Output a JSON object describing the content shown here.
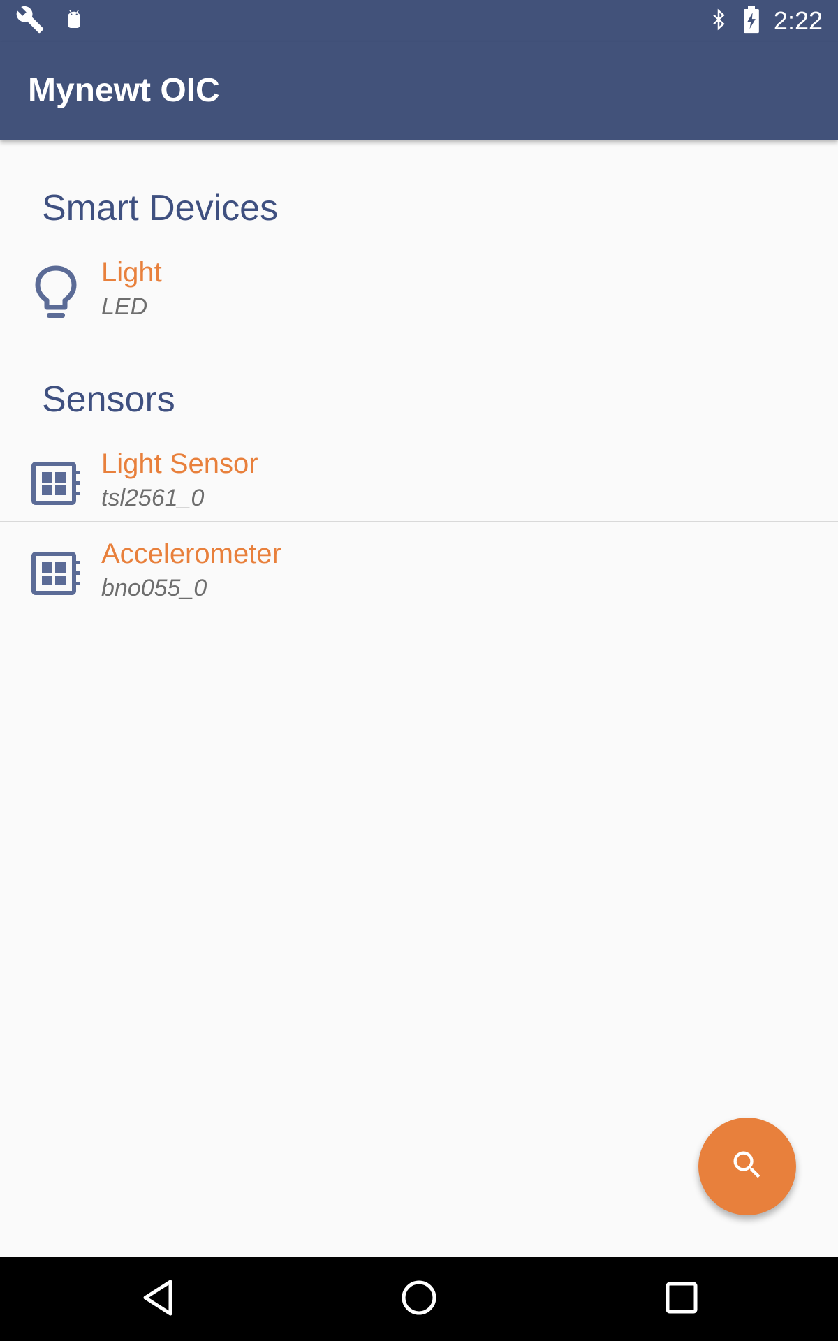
{
  "status_bar": {
    "time": "2:22",
    "icons": [
      "wrench-icon",
      "android-icon",
      "bluetooth-icon",
      "battery-charging-icon"
    ]
  },
  "app_bar": {
    "title": "Mynewt OIC"
  },
  "sections": [
    {
      "header": "Smart Devices",
      "items": [
        {
          "title": "Light",
          "subtitle": "LED",
          "icon": "lightbulb-icon"
        }
      ]
    },
    {
      "header": "Sensors",
      "items": [
        {
          "title": "Light Sensor",
          "subtitle": "tsl2561_0",
          "icon": "chip-icon"
        },
        {
          "title": "Accelerometer",
          "subtitle": "bno055_0",
          "icon": "chip-icon"
        }
      ]
    }
  ],
  "fab": {
    "icon": "search-icon"
  },
  "nav_bar": {
    "buttons": [
      "back-icon",
      "home-icon",
      "recents-icon"
    ]
  },
  "colors": {
    "primary": "#42527a",
    "accent": "#e8803c",
    "header_text": "#3f5080",
    "icon": "#5b6b96",
    "subtitle": "#6e6e6e",
    "background": "#fafafa"
  }
}
